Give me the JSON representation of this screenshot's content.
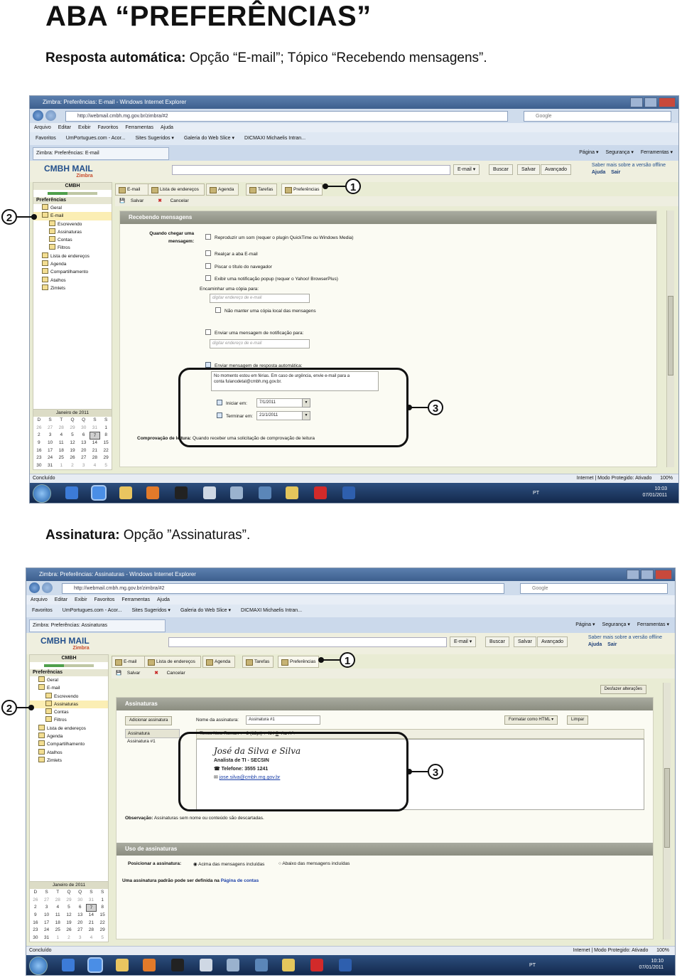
{
  "header": {
    "title": "ABA “PREFERÊNCIAS”",
    "sub1_bold": "Resposta automática:",
    "sub1_text": " Opção “E-mail”; Tópico “Recebendo mensagens”.",
    "sub2_bold": "Assinatura:",
    "sub2_text": " Opção ”Assinaturas”."
  },
  "callouts": {
    "one": "1",
    "two": "2",
    "three": "3"
  },
  "browser": {
    "menu": [
      "Arquivo",
      "Editar",
      "Exibir",
      "Favoritos",
      "Ferramentas",
      "Ajuda"
    ],
    "address": "http://webmail.cmbh.mg.gov.br/zimbra/#2",
    "search_placeholder": "Google",
    "favorites": [
      "Favoritos",
      "UmPortugues.com - Acor...",
      "Sites Sugeridos ▾",
      "Galeria do Web Slice ▾",
      "DICMAXI Michaelis Intran..."
    ],
    "tools": [
      "Página ▾",
      "Segurança ▾",
      "Ferramentas ▾"
    ],
    "status_left": "Concluído",
    "status_right": "Internet | Modo Protegido: Ativado",
    "zoom": "100%",
    "lang": "PT",
    "clock1": {
      "time": "10:03",
      "date": "07/01/2011"
    },
    "clock2": {
      "time": "10:10",
      "date": "07/01/2011"
    }
  },
  "zimbra": {
    "logo": "CMBH MAIL",
    "logo_sub": "Zimbra",
    "header_buttons": [
      "E-mail ▾",
      "Buscar",
      "Salvar",
      "Avançado"
    ],
    "offline_text": "Saber mais sobre a versão offline",
    "help": "Ajuda",
    "logout": "Sair",
    "account": "CMBH",
    "side_head": "Preferências",
    "tabs": [
      "E-mail",
      "Lista de endereços",
      "Agenda",
      "Tarefas",
      "Preferências"
    ],
    "save": "Salvar",
    "cancel": "Cancelar",
    "calendar": {
      "month": "Janeiro de 2011",
      "days": [
        "D",
        "S",
        "T",
        "Q",
        "Q",
        "S",
        "S"
      ],
      "cells": [
        "26",
        "27",
        "28",
        "29",
        "30",
        "31",
        "1",
        "2",
        "3",
        "4",
        "5",
        "6",
        "7",
        "8",
        "9",
        "10",
        "11",
        "12",
        "13",
        "14",
        "15",
        "16",
        "17",
        "18",
        "19",
        "20",
        "21",
        "22",
        "23",
        "24",
        "25",
        "26",
        "27",
        "28",
        "29",
        "30",
        "31",
        "1",
        "2",
        "3",
        "4",
        "5"
      ]
    }
  },
  "shot1": {
    "window_title": "Zimbra: Preferências: E-mail - Windows Internet Explorer",
    "tab_title": "Zimbra: Preferências: E-mail",
    "tree": [
      "Geral",
      "E-mail",
      "Escrevendo",
      "Assinaturas",
      "Contas",
      "Filtros",
      "Lista de endereços",
      "Agenda",
      "Compartilhamento",
      "Atalhos",
      "Zimlets"
    ],
    "section": "Recebendo mensagens",
    "when_label_1": "Quando chegar uma",
    "when_label_2": "mensagem:",
    "options": [
      "Reproduzir um som (requer o plugin QuickTime ou Windows Media)",
      "Realçar a aba E-mail",
      "Piscar o título do navegador",
      "Exibir uma notificação popup (requer o Yahoo! BrowserPlus)"
    ],
    "forward_label": "Encaminhar uma cópia para:",
    "forward_placeholder": "digitar endereço de e-mail",
    "no_local_copy": "Não manter uma cópia local das mensagens",
    "notify_label": "Enviar uma mensagem de notificação para:",
    "notify_placeholder": "digitar endereço de e-mail",
    "auto_reply_label": "Enviar mensagem de resposta automática:",
    "auto_reply_text_1": "No momento estou em férias. Em caso de urgência, envie e-mail para a",
    "auto_reply_text_2": "conta fulanodetal@cmbh.mg.gov.br.",
    "start_label": "Iniciar em:",
    "start_value": "7/1/2011",
    "end_label": "Terminar em:",
    "end_value": "21/1/2011",
    "read_receipt_bold": "Comprovação de leitura:",
    "read_receipt_text": " Quando receber uma solicitação de comprovação de leitura"
  },
  "shot2": {
    "window_title": "Zimbra: Preferências: Assinaturas - Windows Internet Explorer",
    "tab_title": "Zimbra: Preferências: Assinaturas",
    "tree": [
      "Geral",
      "E-mail",
      "Escrevendo",
      "Assinaturas",
      "Contas",
      "Filtros",
      "Lista de endereços",
      "Agenda",
      "Compartilhamento",
      "Atalhos",
      "Zimlets"
    ],
    "undo_button": "Desfazer alterações",
    "section": "Assinaturas",
    "add_button": "Adicionar assinatura",
    "list_head": "Assinatura",
    "list_item": "Assinatura #1",
    "name_label": "Nome da assinatura:",
    "name_value": "Assinatura #1",
    "format_button": "Formatar como HTML ▾",
    "clear_button": "Limpar",
    "font": "Times New Roman",
    "size": "3 (12pt)",
    "sig_name": "José da Silva e Silva",
    "sig_role": "Analista de TI - SECSIN",
    "sig_phone": "Telefone: 3555 1241",
    "sig_email": "jose.silva@cmbh.mg.gov.br",
    "note_bold": "Observação:",
    "note_text": " Assinaturas sem nome ou conteúdo são descartadas.",
    "usage_section": "Uso de assinaturas",
    "position_label": "Posicionar a assinatura:",
    "position_above": "Acima das mensagens incluídas",
    "position_below": "Abaixo das mensagens incluídas",
    "default_text": "Uma assinatura padrão pode ser definida na ",
    "default_link": "Página de contas"
  }
}
